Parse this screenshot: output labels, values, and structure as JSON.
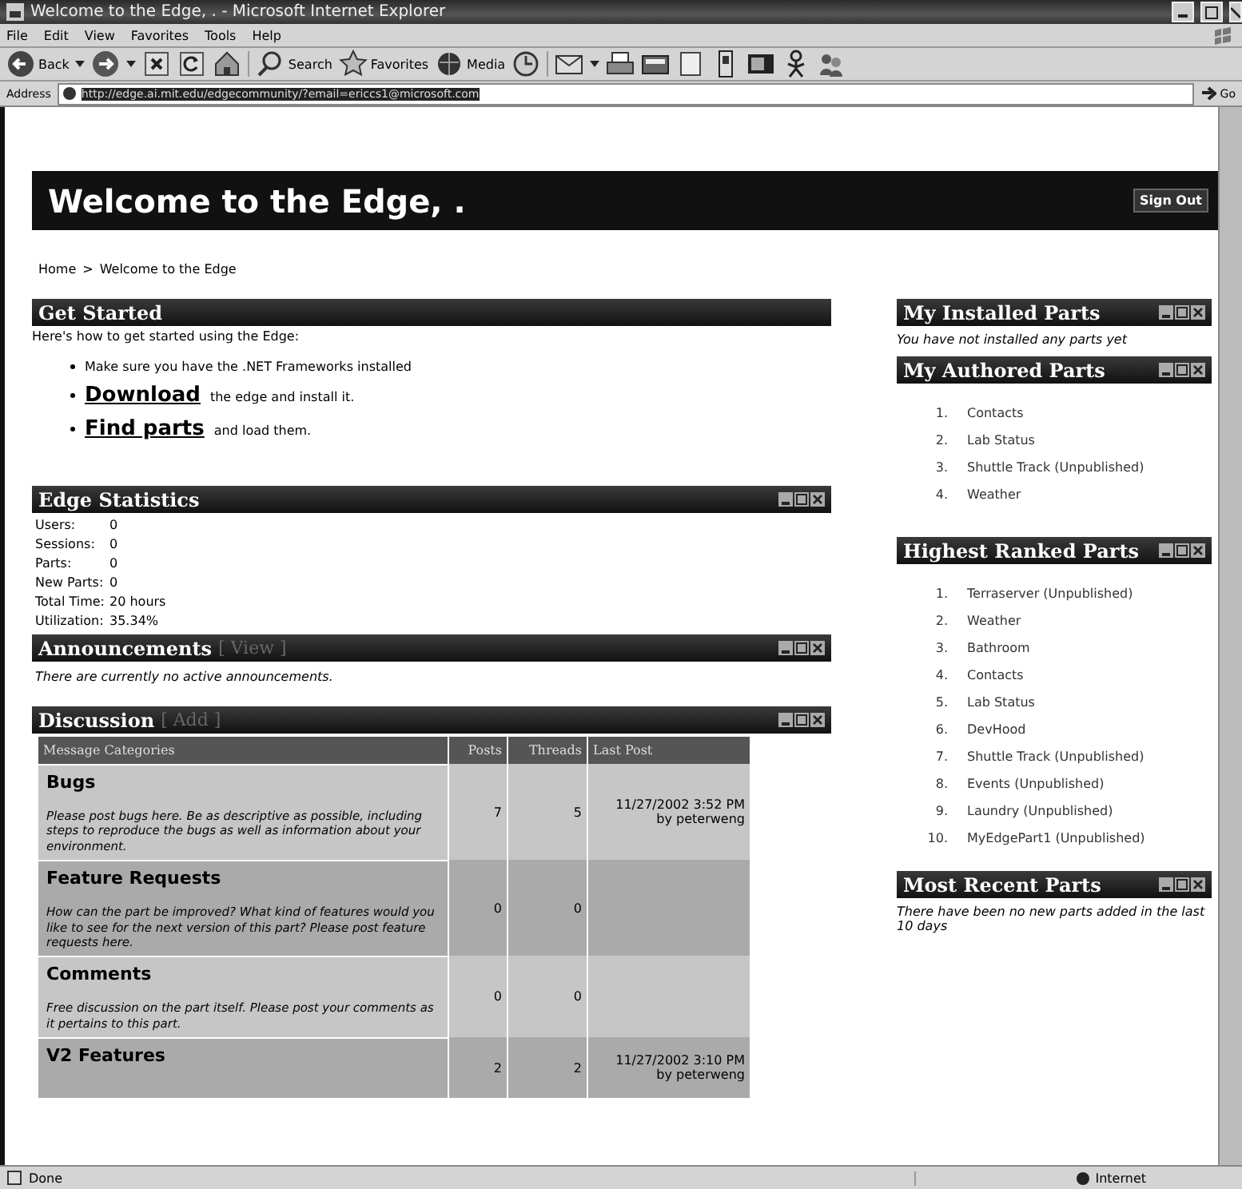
{
  "window": {
    "title": "Welcome to the Edge, . - Microsoft Internet Explorer"
  },
  "menu": [
    "File",
    "Edit",
    "View",
    "Favorites",
    "Tools",
    "Help"
  ],
  "toolbar": [
    {
      "kind": "back",
      "label": "Back",
      "dropdown": true
    },
    {
      "kind": "forward",
      "dropdown": true
    },
    {
      "kind": "stop"
    },
    {
      "kind": "refresh"
    },
    {
      "kind": "home"
    },
    {
      "kind": "search",
      "label": "Search"
    },
    {
      "kind": "favorites",
      "label": "Favorites"
    },
    {
      "kind": "media",
      "label": "Media"
    },
    {
      "kind": "history"
    },
    {
      "kind": "mail",
      "dropdown": true
    },
    {
      "kind": "print"
    },
    {
      "kind": "edit"
    },
    {
      "kind": "note"
    },
    {
      "kind": "phone"
    },
    {
      "kind": "window"
    },
    {
      "kind": "messenger"
    },
    {
      "kind": "people"
    }
  ],
  "address": {
    "label": "Address",
    "url": "http://edge.ai.mit.edu/edgecommunity/?email=ericcs1@microsoft.com",
    "go": "Go"
  },
  "page": {
    "title": "Welcome to the Edge, .",
    "sign_out": "Sign Out",
    "breadcrumb": [
      {
        "label": "Home",
        "separator": ">"
      },
      {
        "label": "Welcome to the Edge"
      }
    ]
  },
  "get_started": {
    "title": "Get Started",
    "controls": false,
    "intro": "Here's how to get started using the Edge:",
    "steps": [
      {
        "text": "Make sure you have the .NET Frameworks installed"
      },
      {
        "link": "Download",
        "text": "the edge and install it."
      },
      {
        "link": "Find parts",
        "text": "and load them."
      }
    ]
  },
  "statistics": {
    "title": "Edge Statistics",
    "controls": true,
    "rows": [
      {
        "label": "Users:",
        "value": "0"
      },
      {
        "label": "Sessions:",
        "value": "0"
      },
      {
        "label": "Parts:",
        "value": "0"
      },
      {
        "label": "New Parts:",
        "value": "0"
      },
      {
        "label": "Total Time:",
        "value": "20 hours"
      },
      {
        "label": "Utilization:",
        "value": "35.34%"
      }
    ]
  },
  "announcements": {
    "title": "Announcements",
    "link": "[ View ]",
    "controls": true,
    "message": "There are currently no active announcements."
  },
  "discussion": {
    "title": "Discussion",
    "link": "[ Add ]",
    "controls": true,
    "columns": [
      "Message Categories",
      "Posts",
      "Threads",
      "Last Post"
    ],
    "rows": [
      {
        "category": "Bugs",
        "description": "Please post bugs here. Be as descriptive as possible, including steps to reproduce the bugs as well as information about your environment.",
        "posts": "7",
        "threads": "5",
        "last_post": "11/27/2002 3:52 PM",
        "by": "by peterweng"
      },
      {
        "category": "Feature Requests",
        "description": "How can the part be improved? What kind of features would you like to see for the next version of this part? Please post feature requests here.",
        "posts": "0",
        "threads": "0"
      },
      {
        "category": "Comments",
        "description": "Free discussion on the part itself. Please post your comments as it pertains to this part.",
        "posts": "0",
        "threads": "0"
      },
      {
        "category": "V2 Features",
        "posts": "2",
        "threads": "2",
        "last_post": "11/27/2002 3:10 PM",
        "by": "by peterweng"
      }
    ]
  },
  "installed": {
    "title": "My Installed Parts",
    "controls": true,
    "message": "You have not installed any parts yet"
  },
  "authored": {
    "title": "My Authored Parts",
    "controls": true,
    "items": [
      {
        "num": "1.",
        "name": "Contacts"
      },
      {
        "num": "2.",
        "name": "Lab Status"
      },
      {
        "num": "3.",
        "name": "Shuttle Track (Unpublished)"
      },
      {
        "num": "4.",
        "name": "Weather"
      }
    ]
  },
  "ranked": {
    "title": "Highest Ranked Parts",
    "controls": true,
    "items": [
      {
        "num": "1.",
        "name": "Terraserver (Unpublished)"
      },
      {
        "num": "2.",
        "name": "Weather"
      },
      {
        "num": "3.",
        "name": "Bathroom"
      },
      {
        "num": "4.",
        "name": "Contacts"
      },
      {
        "num": "5.",
        "name": "Lab Status"
      },
      {
        "num": "6.",
        "name": "DevHood"
      },
      {
        "num": "7.",
        "name": "Shuttle Track (Unpublished)"
      },
      {
        "num": "8.",
        "name": "Events (Unpublished)"
      },
      {
        "num": "9.",
        "name": "Laundry (Unpublished)"
      },
      {
        "num": "10.",
        "name": "MyEdgePart1 (Unpublished)"
      }
    ]
  },
  "recent": {
    "title": "Most Recent Parts",
    "controls": true,
    "message": "There have been no new parts added in the last 10 days"
  },
  "status_bar": {
    "text": "Done",
    "zone": "Internet"
  }
}
